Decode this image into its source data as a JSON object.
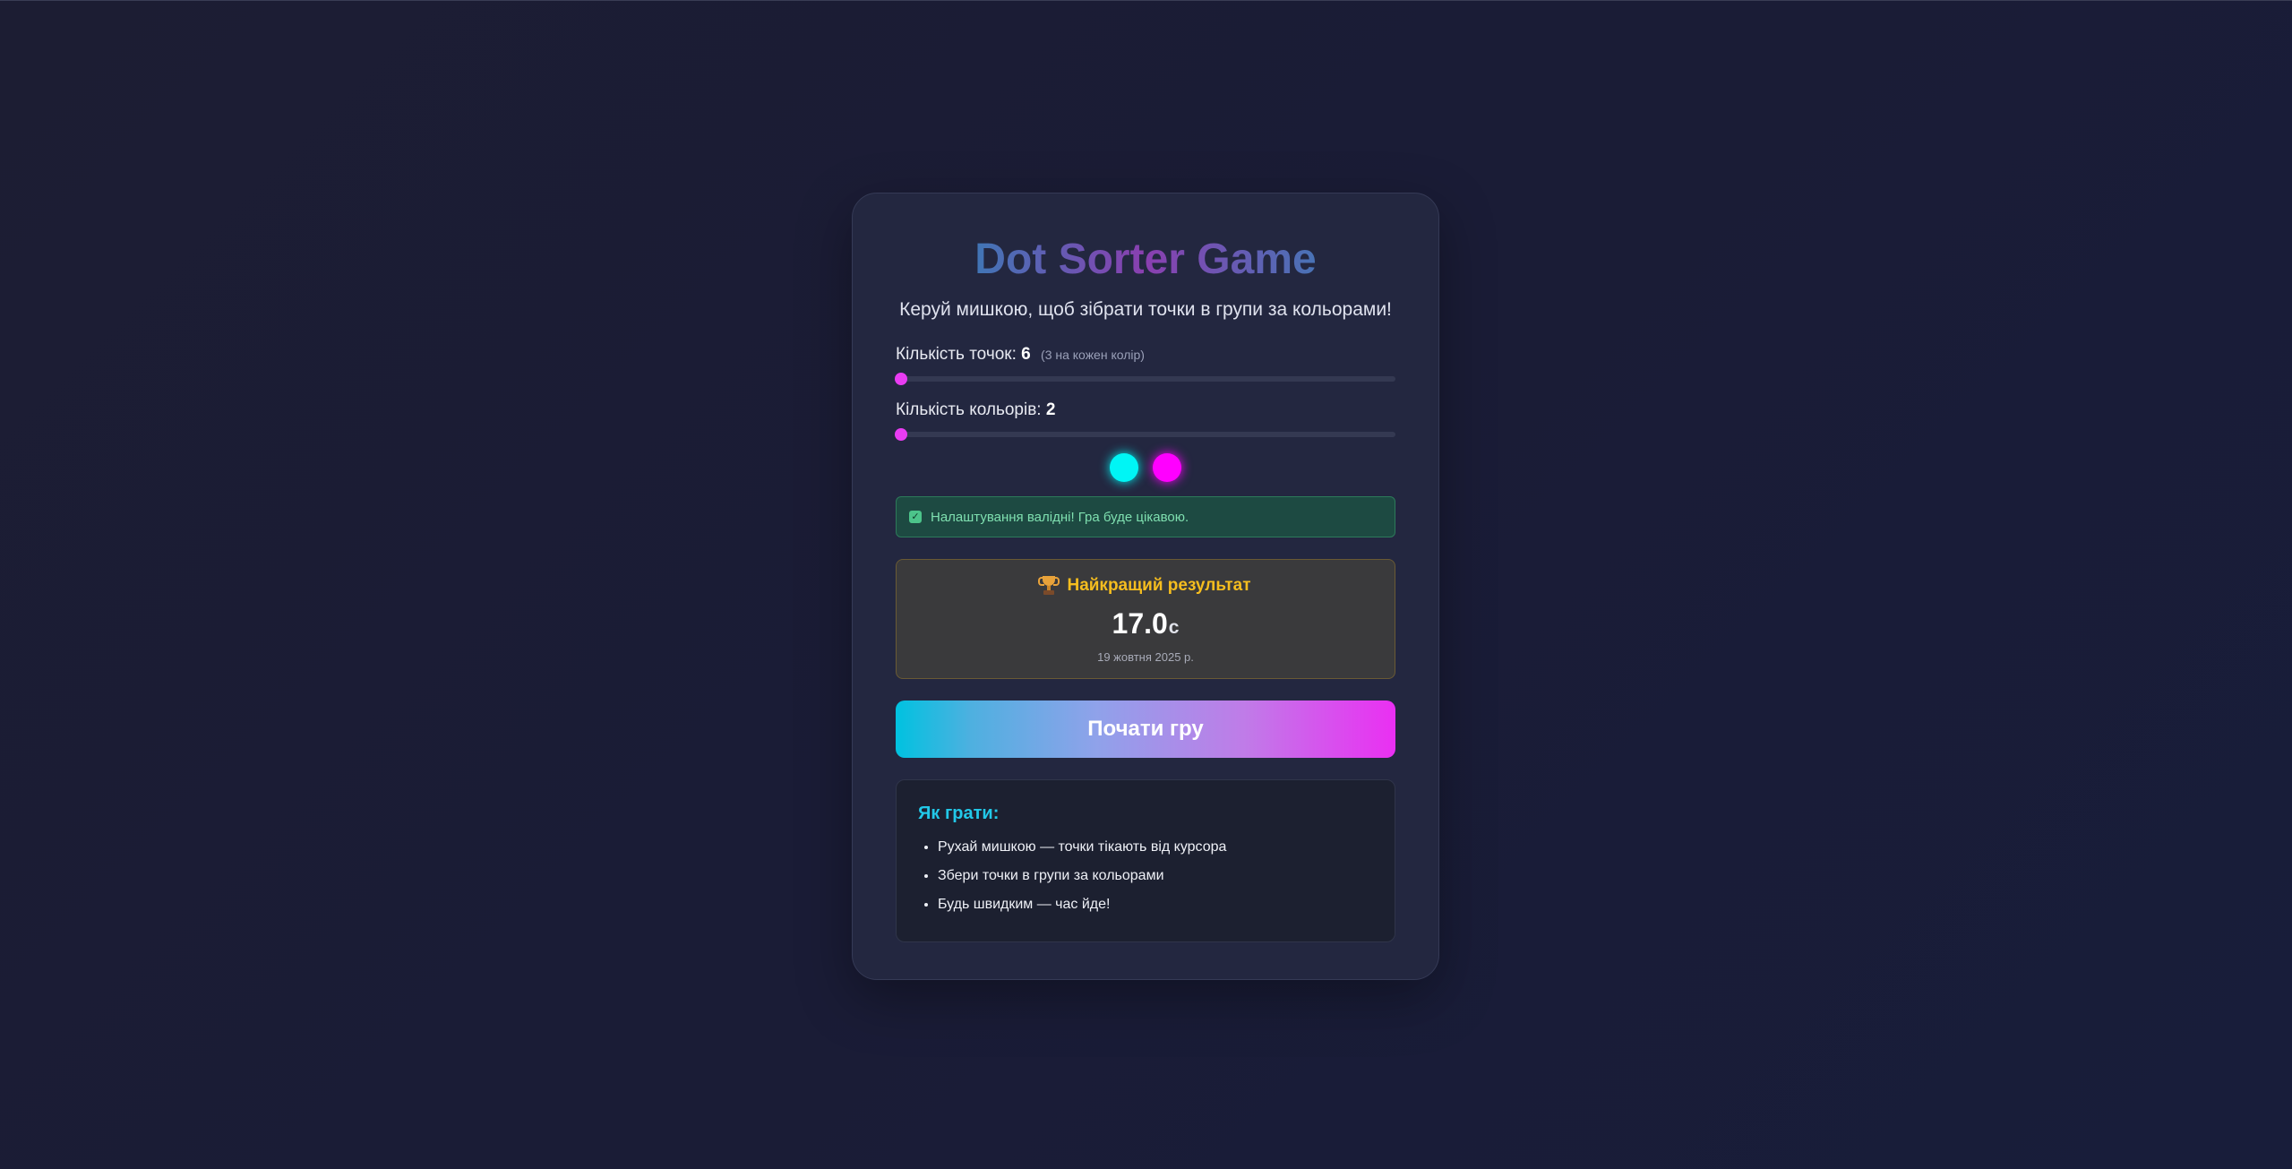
{
  "title": "Dot Sorter Game",
  "subtitle": "Керуй мишкою, щоб зібрати точки в групи за кольорами!",
  "dots_setting": {
    "label": "Кількість точок: ",
    "value": "6",
    "hint": "(3 на кожен колір)",
    "slider_fraction": 0.0
  },
  "colors_setting": {
    "label": "Кількість кольорів: ",
    "value": "2",
    "slider_fraction": 0.0
  },
  "color_swatches": [
    "#00f5f5",
    "#ff00ff"
  ],
  "validation": {
    "text": "Налаштування валідні! Гра буде цікавою.",
    "icon": "checkmark-icon"
  },
  "best": {
    "icon": "trophy-icon",
    "title": "Найкращий результат",
    "score": "17.0",
    "unit": "с",
    "date": "19 жовтня 2025 р."
  },
  "start_button": "Почати гру",
  "howto": {
    "title": "Як грати:",
    "items": [
      "Рухай мишкою — точки тікають від курсора",
      "Збери точки в групи за кольорами",
      "Будь швидким — час йде!"
    ]
  },
  "colors": {
    "accent_pink": "#e83cf2",
    "accent_cyan": "#22c8e8",
    "gold": "#f5bd1f",
    "success": "#7fe0b0"
  }
}
